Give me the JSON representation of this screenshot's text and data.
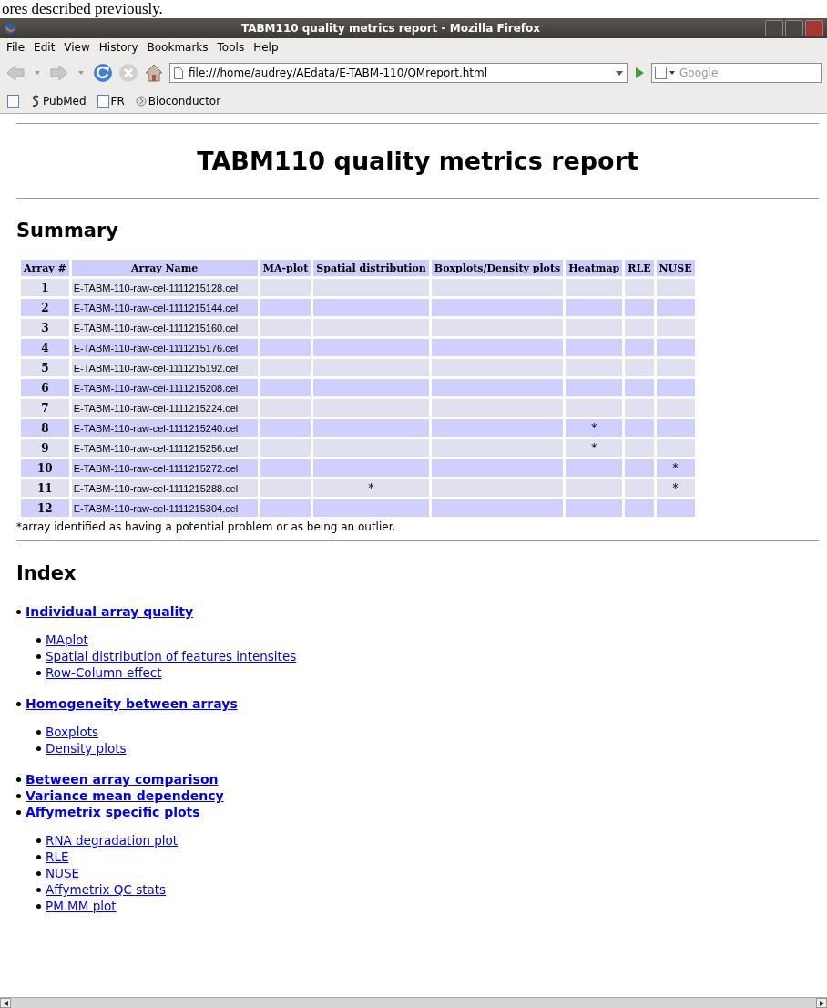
{
  "document_text": "ores described previously.",
  "window": {
    "title": "TABM110 quality metrics report - Mozilla Firefox"
  },
  "menu": [
    {
      "label": "File"
    },
    {
      "label": "Edit"
    },
    {
      "label": "View"
    },
    {
      "label": "History"
    },
    {
      "label": "Bookmarks"
    },
    {
      "label": "Tools"
    },
    {
      "label": "Help"
    }
  ],
  "address": {
    "value": "file:///home/audrey/AEdata/E-TABM-110/QMreport.html"
  },
  "search": {
    "placeholder": "Google"
  },
  "bookmarks": [
    {
      "label": "PubMed"
    },
    {
      "label": "FR"
    },
    {
      "label": "Bioconductor"
    }
  ],
  "page": {
    "title": "TABM110 quality metrics report",
    "summary_heading": "Summary",
    "table": {
      "columns": [
        "Array #",
        "Array Name",
        "MA-plot",
        "Spatial distribution",
        "Boxplots/Density plots",
        "Heatmap",
        "RLE",
        "NUSE"
      ],
      "rows": [
        {
          "cells": [
            "1",
            "E-TABM-110-raw-cel-1111215128.cel",
            "",
            "",
            "",
            "",
            "",
            ""
          ]
        },
        {
          "cells": [
            "2",
            "E-TABM-110-raw-cel-1111215144.cel",
            "",
            "",
            "",
            "",
            "",
            ""
          ]
        },
        {
          "cells": [
            "3",
            "E-TABM-110-raw-cel-1111215160.cel",
            "",
            "",
            "",
            "",
            "",
            ""
          ]
        },
        {
          "cells": [
            "4",
            "E-TABM-110-raw-cel-1111215176.cel",
            "",
            "",
            "",
            "",
            "",
            ""
          ]
        },
        {
          "cells": [
            "5",
            "E-TABM-110-raw-cel-1111215192.cel",
            "",
            "",
            "",
            "",
            "",
            ""
          ]
        },
        {
          "cells": [
            "6",
            "E-TABM-110-raw-cel-1111215208.cel",
            "",
            "",
            "",
            "",
            "",
            ""
          ]
        },
        {
          "cells": [
            "7",
            "E-TABM-110-raw-cel-1111215224.cel",
            "",
            "",
            "",
            "",
            "",
            ""
          ]
        },
        {
          "cells": [
            "8",
            "E-TABM-110-raw-cel-1111215240.cel",
            "",
            "",
            "",
            "*",
            "",
            ""
          ]
        },
        {
          "cells": [
            "9",
            "E-TABM-110-raw-cel-1111215256.cel",
            "",
            "",
            "",
            "*",
            "",
            ""
          ]
        },
        {
          "cells": [
            "10",
            "E-TABM-110-raw-cel-1111215272.cel",
            "",
            "",
            "",
            "",
            "",
            "*"
          ]
        },
        {
          "cells": [
            "11",
            "E-TABM-110-raw-cel-1111215288.cel",
            "",
            "*",
            "",
            "",
            "",
            "*"
          ]
        },
        {
          "cells": [
            "12",
            "E-TABM-110-raw-cel-1111215304.cel",
            "",
            "",
            "",
            "",
            "",
            ""
          ]
        }
      ]
    },
    "footnote": "*array identified as having a potential problem or as being an outlier.",
    "index_heading": "Index",
    "index": [
      {
        "label": "Individual array quality",
        "children": [
          {
            "label": "MAplot"
          },
          {
            "label": "Spatial distribution of features intensites"
          },
          {
            "label": "Row-Column effect"
          }
        ]
      },
      {
        "label": "Homogeneity between arrays",
        "children": [
          {
            "label": "Boxplots"
          },
          {
            "label": "Density plots"
          }
        ]
      },
      {
        "label": "Between array comparison"
      },
      {
        "label": "Variance mean dependency"
      },
      {
        "label": "Affymetrix specific plots",
        "children": [
          {
            "label": "RNA degradation plot"
          },
          {
            "label": "RLE"
          },
          {
            "label": "NUSE"
          },
          {
            "label": "Affymetrix QC stats"
          },
          {
            "label": "PM MM plot"
          }
        ]
      }
    ]
  }
}
